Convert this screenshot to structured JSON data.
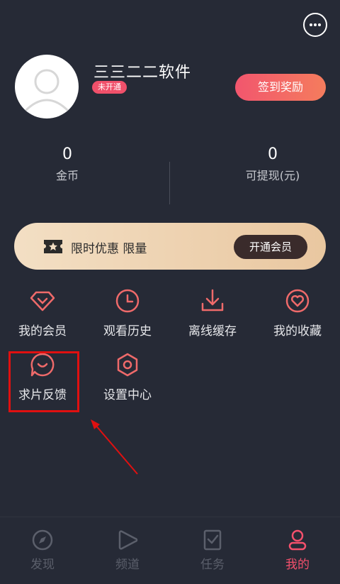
{
  "header": {
    "message_icon": "chat-bubble-dots-icon"
  },
  "profile": {
    "username": "三三二二软件",
    "vip_status": "未开通",
    "signin_label": "签到奖励"
  },
  "stats": [
    {
      "value": "0",
      "label": "金币"
    },
    {
      "value": "0",
      "label": "可提现(元)"
    }
  ],
  "vip_banner": {
    "text": "限时优惠 限量",
    "button_label": "开通会员",
    "icon": "star-ticket-icon"
  },
  "menu": [
    {
      "label": "我的会员",
      "icon": "diamond-icon"
    },
    {
      "label": "观看历史",
      "icon": "clock-icon"
    },
    {
      "label": "离线缓存",
      "icon": "download-icon"
    },
    {
      "label": "我的收藏",
      "icon": "heart-icon"
    },
    {
      "label": "求片反馈",
      "icon": "chat-smile-icon"
    },
    {
      "label": "设置中心",
      "icon": "settings-hexagon-icon"
    }
  ],
  "bottom_nav": [
    {
      "label": "发现",
      "icon": "compass-icon",
      "active": false
    },
    {
      "label": "频道",
      "icon": "play-icon",
      "active": false
    },
    {
      "label": "任务",
      "icon": "task-check-icon",
      "active": false
    },
    {
      "label": "我的",
      "icon": "user-icon",
      "active": true
    }
  ],
  "colors": {
    "background": "#262a36",
    "accent": "#f4506c",
    "icon_stroke": "#ef6a6a",
    "highlight": "#e01010"
  }
}
